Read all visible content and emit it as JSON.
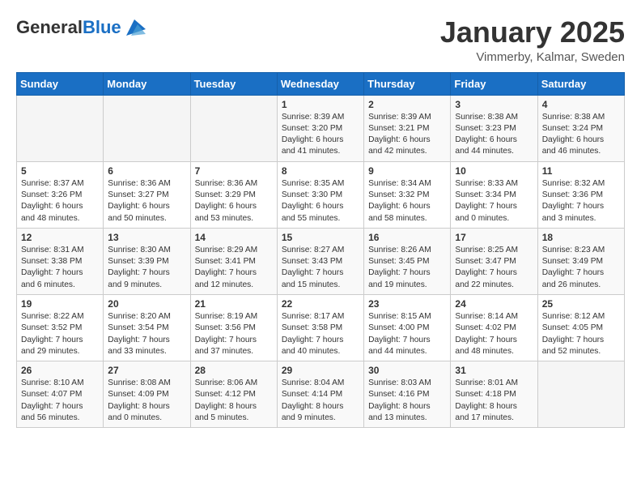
{
  "logo": {
    "general": "General",
    "blue": "Blue"
  },
  "header": {
    "month_title": "January 2025",
    "location": "Vimmerby, Kalmar, Sweden"
  },
  "weekdays": [
    "Sunday",
    "Monday",
    "Tuesday",
    "Wednesday",
    "Thursday",
    "Friday",
    "Saturday"
  ],
  "weeks": [
    [
      {
        "day": "",
        "content": ""
      },
      {
        "day": "",
        "content": ""
      },
      {
        "day": "",
        "content": ""
      },
      {
        "day": "1",
        "content": "Sunrise: 8:39 AM\nSunset: 3:20 PM\nDaylight: 6 hours\nand 41 minutes."
      },
      {
        "day": "2",
        "content": "Sunrise: 8:39 AM\nSunset: 3:21 PM\nDaylight: 6 hours\nand 42 minutes."
      },
      {
        "day": "3",
        "content": "Sunrise: 8:38 AM\nSunset: 3:23 PM\nDaylight: 6 hours\nand 44 minutes."
      },
      {
        "day": "4",
        "content": "Sunrise: 8:38 AM\nSunset: 3:24 PM\nDaylight: 6 hours\nand 46 minutes."
      }
    ],
    [
      {
        "day": "5",
        "content": "Sunrise: 8:37 AM\nSunset: 3:26 PM\nDaylight: 6 hours\nand 48 minutes."
      },
      {
        "day": "6",
        "content": "Sunrise: 8:36 AM\nSunset: 3:27 PM\nDaylight: 6 hours\nand 50 minutes."
      },
      {
        "day": "7",
        "content": "Sunrise: 8:36 AM\nSunset: 3:29 PM\nDaylight: 6 hours\nand 53 minutes."
      },
      {
        "day": "8",
        "content": "Sunrise: 8:35 AM\nSunset: 3:30 PM\nDaylight: 6 hours\nand 55 minutes."
      },
      {
        "day": "9",
        "content": "Sunrise: 8:34 AM\nSunset: 3:32 PM\nDaylight: 6 hours\nand 58 minutes."
      },
      {
        "day": "10",
        "content": "Sunrise: 8:33 AM\nSunset: 3:34 PM\nDaylight: 7 hours\nand 0 minutes."
      },
      {
        "day": "11",
        "content": "Sunrise: 8:32 AM\nSunset: 3:36 PM\nDaylight: 7 hours\nand 3 minutes."
      }
    ],
    [
      {
        "day": "12",
        "content": "Sunrise: 8:31 AM\nSunset: 3:38 PM\nDaylight: 7 hours\nand 6 minutes."
      },
      {
        "day": "13",
        "content": "Sunrise: 8:30 AM\nSunset: 3:39 PM\nDaylight: 7 hours\nand 9 minutes."
      },
      {
        "day": "14",
        "content": "Sunrise: 8:29 AM\nSunset: 3:41 PM\nDaylight: 7 hours\nand 12 minutes."
      },
      {
        "day": "15",
        "content": "Sunrise: 8:27 AM\nSunset: 3:43 PM\nDaylight: 7 hours\nand 15 minutes."
      },
      {
        "day": "16",
        "content": "Sunrise: 8:26 AM\nSunset: 3:45 PM\nDaylight: 7 hours\nand 19 minutes."
      },
      {
        "day": "17",
        "content": "Sunrise: 8:25 AM\nSunset: 3:47 PM\nDaylight: 7 hours\nand 22 minutes."
      },
      {
        "day": "18",
        "content": "Sunrise: 8:23 AM\nSunset: 3:49 PM\nDaylight: 7 hours\nand 26 minutes."
      }
    ],
    [
      {
        "day": "19",
        "content": "Sunrise: 8:22 AM\nSunset: 3:52 PM\nDaylight: 7 hours\nand 29 minutes."
      },
      {
        "day": "20",
        "content": "Sunrise: 8:20 AM\nSunset: 3:54 PM\nDaylight: 7 hours\nand 33 minutes."
      },
      {
        "day": "21",
        "content": "Sunrise: 8:19 AM\nSunset: 3:56 PM\nDaylight: 7 hours\nand 37 minutes."
      },
      {
        "day": "22",
        "content": "Sunrise: 8:17 AM\nSunset: 3:58 PM\nDaylight: 7 hours\nand 40 minutes."
      },
      {
        "day": "23",
        "content": "Sunrise: 8:15 AM\nSunset: 4:00 PM\nDaylight: 7 hours\nand 44 minutes."
      },
      {
        "day": "24",
        "content": "Sunrise: 8:14 AM\nSunset: 4:02 PM\nDaylight: 7 hours\nand 48 minutes."
      },
      {
        "day": "25",
        "content": "Sunrise: 8:12 AM\nSunset: 4:05 PM\nDaylight: 7 hours\nand 52 minutes."
      }
    ],
    [
      {
        "day": "26",
        "content": "Sunrise: 8:10 AM\nSunset: 4:07 PM\nDaylight: 7 hours\nand 56 minutes."
      },
      {
        "day": "27",
        "content": "Sunrise: 8:08 AM\nSunset: 4:09 PM\nDaylight: 8 hours\nand 0 minutes."
      },
      {
        "day": "28",
        "content": "Sunrise: 8:06 AM\nSunset: 4:12 PM\nDaylight: 8 hours\nand 5 minutes."
      },
      {
        "day": "29",
        "content": "Sunrise: 8:04 AM\nSunset: 4:14 PM\nDaylight: 8 hours\nand 9 minutes."
      },
      {
        "day": "30",
        "content": "Sunrise: 8:03 AM\nSunset: 4:16 PM\nDaylight: 8 hours\nand 13 minutes."
      },
      {
        "day": "31",
        "content": "Sunrise: 8:01 AM\nSunset: 4:18 PM\nDaylight: 8 hours\nand 17 minutes."
      },
      {
        "day": "",
        "content": ""
      }
    ]
  ]
}
